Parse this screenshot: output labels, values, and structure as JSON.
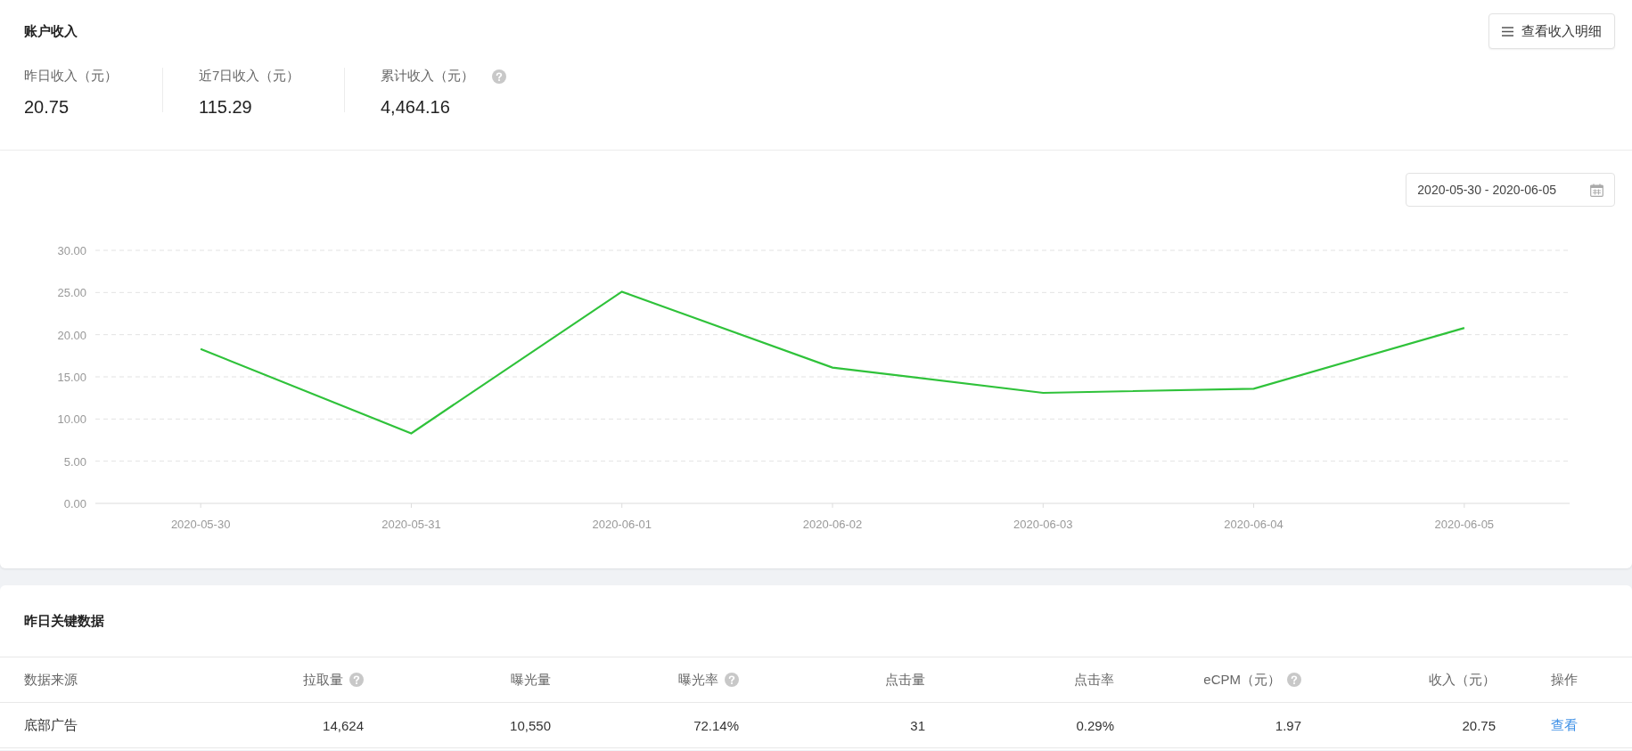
{
  "income": {
    "title": "账户收入",
    "detail_button": "查看收入明细",
    "stats": [
      {
        "label": "昨日收入（元）",
        "value": "20.75",
        "help": false
      },
      {
        "label": "近7日收入（元）",
        "value": "115.29",
        "help": false
      },
      {
        "label": "累计收入（元）",
        "value": "4,464.16",
        "help": true
      }
    ]
  },
  "trend": {
    "date_range": "2020-05-30 - 2020-06-05",
    "chart_data": {
      "type": "line",
      "categories": [
        "2020-05-30",
        "2020-05-31",
        "2020-06-01",
        "2020-06-02",
        "2020-06-03",
        "2020-06-04",
        "2020-06-05"
      ],
      "grid": true,
      "series": [
        {
          "color": "#2fc23a",
          "values": [
            18.3,
            8.3,
            25.1,
            16.1,
            13.1,
            13.6,
            20.8
          ]
        }
      ],
      "ylim": [
        0,
        30
      ],
      "yticks": [
        {
          "value": 0,
          "label": "0.00"
        },
        {
          "value": 5,
          "label": "5.00"
        },
        {
          "value": 10,
          "label": "10.00"
        },
        {
          "value": 15,
          "label": "15.00"
        },
        {
          "value": 20,
          "label": "20.00"
        },
        {
          "value": 25,
          "label": "25.00"
        },
        {
          "value": 30,
          "label": "30.00"
        }
      ]
    }
  },
  "key_data": {
    "title": "昨日关键数据",
    "columns": [
      {
        "label": "数据来源",
        "help": false
      },
      {
        "label": "拉取量",
        "help": true
      },
      {
        "label": "曝光量",
        "help": false
      },
      {
        "label": "曝光率",
        "help": true
      },
      {
        "label": "点击量",
        "help": false
      },
      {
        "label": "点击率",
        "help": false
      },
      {
        "label": "eCPM（元）",
        "help": true
      },
      {
        "label": "收入（元）",
        "help": false
      },
      {
        "label": "操作",
        "help": false
      }
    ],
    "rows": [
      {
        "cells": [
          "底部广告",
          "14,624",
          "10,550",
          "72.14%",
          "31",
          "0.29%",
          "1.97",
          "20.75"
        ],
        "action": "查看"
      }
    ]
  }
}
